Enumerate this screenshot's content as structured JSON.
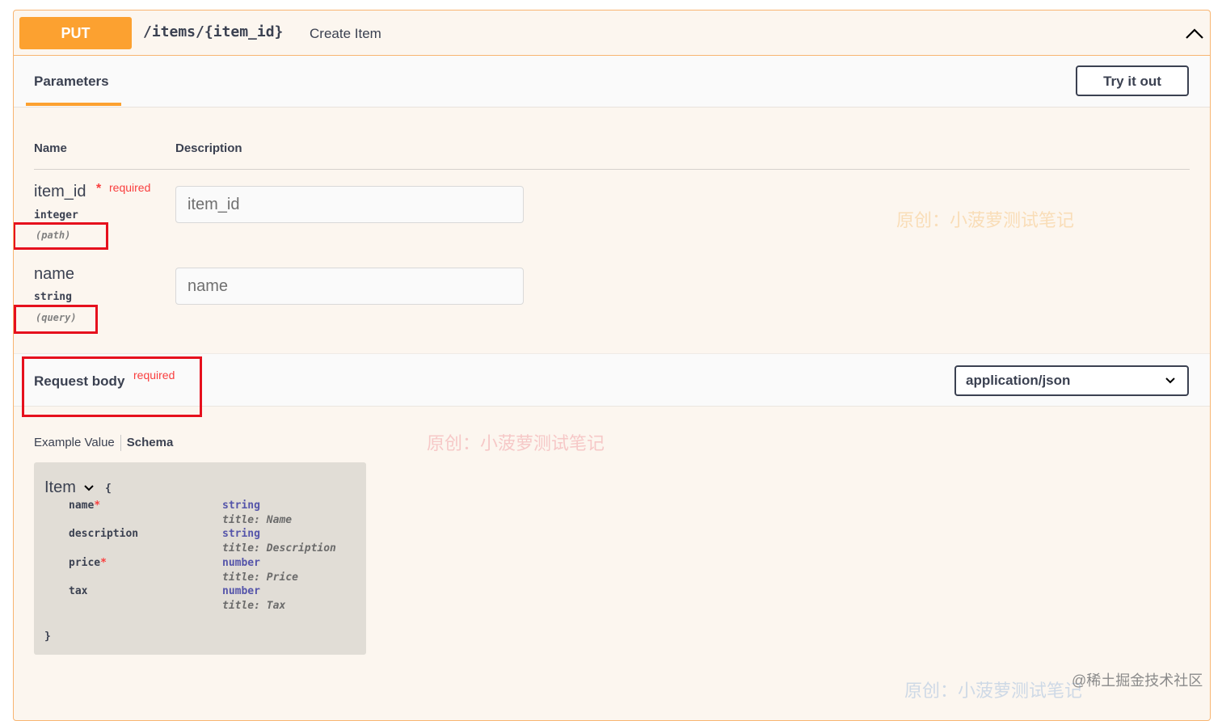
{
  "summary": {
    "method": "PUT",
    "path": "/items/{item_id}",
    "description": "Create Item"
  },
  "tabs": {
    "parameters": "Parameters",
    "try_it_out": "Try it out"
  },
  "table": {
    "col_name": "Name",
    "col_description": "Description"
  },
  "params": [
    {
      "name": "item_id",
      "required_star": "*",
      "required_text": "required",
      "type": "integer",
      "in": "(path)",
      "placeholder": "item_id"
    },
    {
      "name": "name",
      "type": "string",
      "in": "(query)",
      "placeholder": "name"
    }
  ],
  "request_body": {
    "title": "Request body",
    "required_text": "required",
    "content_type": "application/json"
  },
  "example_tabs": {
    "example_value": "Example Value",
    "schema": "Schema"
  },
  "schema": {
    "model": "Item",
    "open_brace": "{",
    "close_brace": "}",
    "properties": [
      {
        "name": "name",
        "star": "*",
        "type": "string",
        "title": "title: Name"
      },
      {
        "name": "description",
        "star": "",
        "type": "string",
        "title": "title: Description"
      },
      {
        "name": "price",
        "star": "*",
        "type": "number",
        "title": "title: Price"
      },
      {
        "name": "tax",
        "star": "",
        "type": "number",
        "title": "title: Tax"
      }
    ]
  },
  "watermarks": {
    "text": "原创：小菠萝测试笔记",
    "corner": "@稀土掘金技术社区",
    "colors": {
      "orange": "#f8c98a",
      "pink": "#f2a3a8",
      "blue": "#a9c2e0"
    }
  }
}
